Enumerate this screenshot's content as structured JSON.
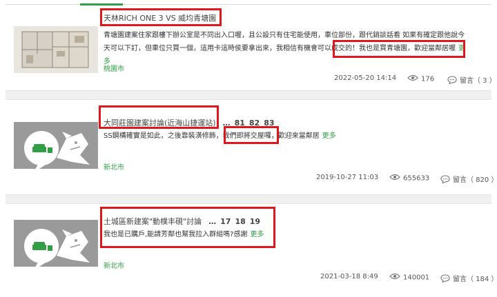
{
  "posts": [
    {
      "title": "天林RICH ONE 3 VS 威均青塘園",
      "pages": [],
      "excerpt": "青塘園建案住家跟樓下辦公室是不同出入口喔，且公設只有住宅能使用，車位部份，跟代銷談話看 如果有確定跟他說今天可以下訂，但車位只買一個，這用卡這時侯要拿出來，我相信有機會可以成交的！我也是買青塘園，歡迎當鄰居喔",
      "more": "更多",
      "location": "桃園市",
      "date": "2022-05-20 14:14",
      "views": "176",
      "comments": "留言（ 3 ）",
      "thumb_icon": "floorplan-image"
    },
    {
      "title": "大同莊園建案討論(近海山捷運站)",
      "pages": [
        "…",
        "81",
        "82",
        "83"
      ],
      "excerpt": "SS鋼構確實是如此，之後靠裝潢修飾，我們即將交屋囉，歡迎來當鄰居",
      "more": "更多",
      "location": "新北市",
      "date": "2019-10-27 11:03",
      "views": "655633",
      "comments": "留言（ 820 ）",
      "thumb_icon": "sofa-chat-placeholder-icon"
    },
    {
      "title": "土城區新建案\"動樸丰硯\"討論",
      "pages": [
        "…",
        "17",
        "18",
        "19"
      ],
      "excerpt": "我也是已購戶,能請芳鄰也幫我拉入群組嗎?感謝",
      "more": "更多",
      "location": "新北市",
      "date": "2021-03-18 8:49",
      "views": "140001",
      "comments": "留言（ 184 ）",
      "thumb_icon": "sofa-chat-placeholder-icon"
    }
  ],
  "colors": {
    "accent": "#2f9e44",
    "highlight": "#e0161c",
    "placeholder": "#9a9a9a"
  },
  "icons": {
    "views": "eye-icon",
    "comments": "chat-bubble-icon"
  }
}
